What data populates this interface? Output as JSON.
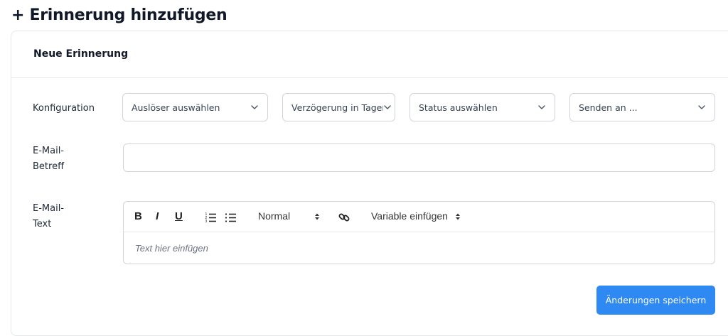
{
  "page": {
    "title": "+ Erinnerung hinzufügen"
  },
  "card": {
    "title": "Neue Erinnerung"
  },
  "configuration": {
    "label": "Konfiguration",
    "trigger_select": "Auslöser auswählen",
    "delay_select": "Verzögerung in Tagen",
    "status_select": "Status auswählen",
    "send_to_select": "Senden an ..."
  },
  "subject": {
    "label_line1": "E-Mail-",
    "label_line2": "Betreff",
    "value": ""
  },
  "body": {
    "label_line1": "E-Mail-",
    "label_line2": "Text",
    "toolbar": {
      "bold": "B",
      "italic": "I",
      "underline": "U",
      "format_select": "Normal",
      "variable_select": "Variable einfügen"
    },
    "placeholder": "Text hier einfügen"
  },
  "actions": {
    "save_label": "Änderungen speichern"
  },
  "colors": {
    "primary": "#2e89f3",
    "border": "#d1d5db"
  },
  "icons": {
    "chevron": "chevron-down-icon",
    "ordered_list": "ordered-list-icon",
    "bullet_list": "bullet-list-icon",
    "link": "link-icon",
    "sort": "up-down-arrows-icon"
  }
}
